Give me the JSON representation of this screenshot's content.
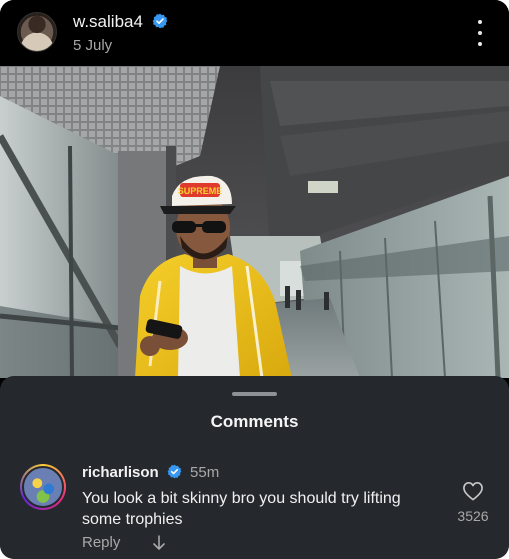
{
  "post": {
    "username": "w.saliba4",
    "date": "5 July",
    "verified": true,
    "cap_text": "SUPREME"
  },
  "comments_sheet": {
    "title": "Comments",
    "comments": [
      {
        "author": "richarlison",
        "verified": true,
        "time": "55m",
        "text": "You look a bit skinny bro you should try lifting some trophies",
        "likes": "3526",
        "reply_label": "Reply"
      }
    ]
  },
  "icons": {
    "verified": "verified-badge-icon",
    "more": "more-vertical-icon",
    "like": "heart-outline-icon",
    "expand": "arrow-down-icon"
  },
  "colors": {
    "verified_blue": "#3897f0",
    "sheet_background": "#25292e",
    "jacket_yellow": "#f2c417"
  }
}
